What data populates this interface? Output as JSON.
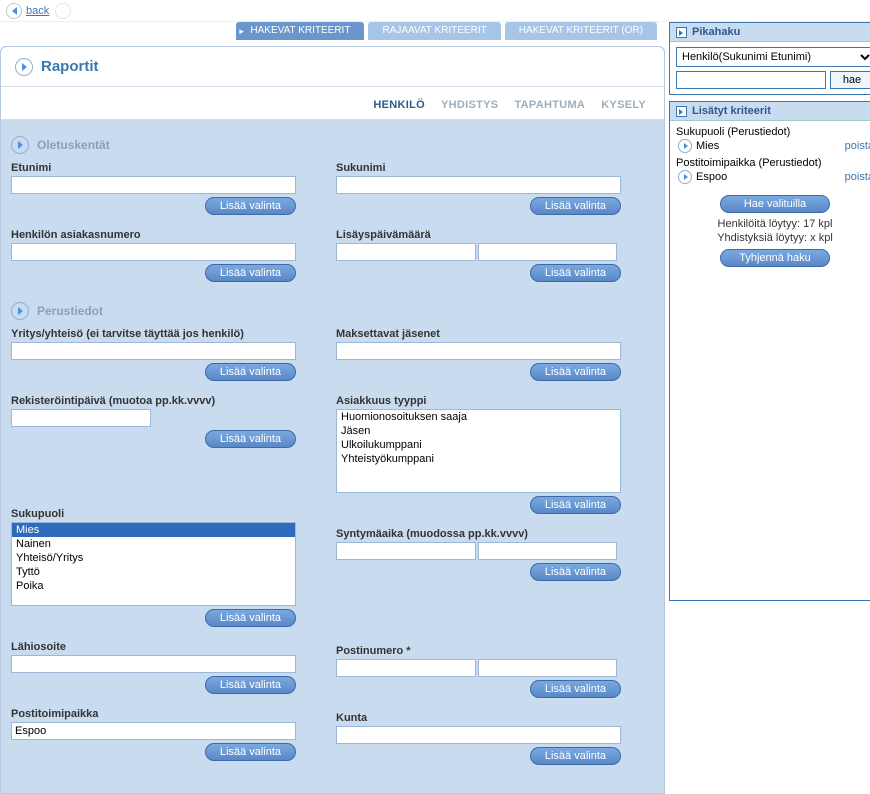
{
  "nav": {
    "back_label": "back"
  },
  "tabs": [
    {
      "label": "HAKEVAT KRITEERIT",
      "active": true
    },
    {
      "label": "RAJAAVAT KRITEERIT",
      "active": false
    },
    {
      "label": "HAKEVAT KRITEERIT (OR)",
      "active": false
    }
  ],
  "page_title": "Raportit",
  "subtabs": [
    {
      "label": "HENKILÖ",
      "active": true
    },
    {
      "label": "YHDISTYS",
      "active": false
    },
    {
      "label": "TAPAHTUMA",
      "active": false
    },
    {
      "label": "KYSELY",
      "active": false
    }
  ],
  "sections": {
    "defaults": {
      "heading": "Oletuskentät"
    },
    "basic": {
      "heading": "Perustiedot"
    }
  },
  "labels": {
    "etunimi": "Etunimi",
    "sukunimi": "Sukunimi",
    "asiakasnumero": "Henkilön asiakasnumero",
    "lisayspvm": "Lisäyspäivämäärä",
    "yritys": "Yritys/yhteisö (ei tarvitse täyttää jos henkilö)",
    "maksettavat": "Maksettavat jäsenet",
    "rekpvm": "Rekisteröintipäivä (muotoa pp.kk.vvvv)",
    "asiakkuus": "Asiakkuus tyyppi",
    "sukupuoli": "Sukupuoli",
    "syntymaaika": "Syntymäaika (muodossa pp.kk.vvvv)",
    "lahiosoite": "Lähiosoite",
    "postinumero": "Postinumero *",
    "postitoimipaikka": "Postitoimipaikka",
    "kunta": "Kunta"
  },
  "values": {
    "postitoimipaikka": "Espoo"
  },
  "lists": {
    "asiakkuus": [
      "Huomionosoituksen saaja",
      "Jäsen",
      "Ulkoilukumppani",
      "Yhteistyökumppani"
    ],
    "sukupuoli": [
      "Mies",
      "Nainen",
      "Yhteisö/Yritys",
      "Tyttö",
      "Poika"
    ],
    "sukupuoli_selected": "Mies"
  },
  "buttons": {
    "lisaa": "Lisää valinta",
    "hae_valituilla": "Hae valituilla",
    "tyhjenna": "Tyhjennä haku",
    "hae": "hae"
  },
  "quicksearch": {
    "title": "Pikahaku",
    "select_value": "Henkilö(Sukunimi Etunimi)"
  },
  "added": {
    "title": "Lisätyt kriteerit",
    "items": [
      {
        "group": "Sukupuoli (Perustiedot)",
        "value": "Mies",
        "remove": "poista"
      },
      {
        "group": "Postitoimipaikka (Perustiedot)",
        "value": "Espoo",
        "remove": "poista"
      }
    ],
    "stats": {
      "henkiloita": "Henkilöitä löytyy: 17 kpl",
      "yhdistyksia": "Yhdistyksiä löytyy: x kpl"
    }
  }
}
